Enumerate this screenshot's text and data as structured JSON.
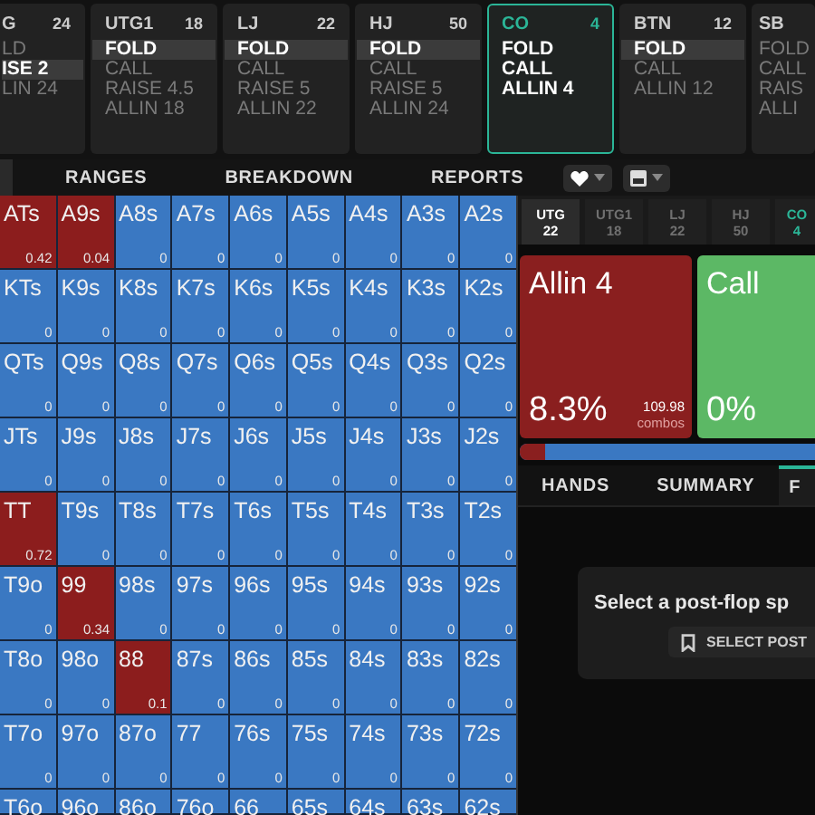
{
  "positions": [
    {
      "name": "G",
      "stack": "24",
      "active": false,
      "actions": [
        {
          "label": "LD",
          "selected": false
        },
        {
          "label": "ISE 2",
          "selected": true
        },
        {
          "label": "LIN 24",
          "selected": false
        }
      ]
    },
    {
      "name": "UTG1",
      "stack": "18",
      "active": false,
      "actions": [
        {
          "label": "FOLD",
          "selected": true
        },
        {
          "label": "CALL",
          "selected": false
        },
        {
          "label": "RAISE 4.5",
          "selected": false
        },
        {
          "label": "ALLIN 18",
          "selected": false
        }
      ]
    },
    {
      "name": "LJ",
      "stack": "22",
      "active": false,
      "actions": [
        {
          "label": "FOLD",
          "selected": true
        },
        {
          "label": "CALL",
          "selected": false
        },
        {
          "label": "RAISE 5",
          "selected": false
        },
        {
          "label": "ALLIN 22",
          "selected": false
        }
      ]
    },
    {
      "name": "HJ",
      "stack": "50",
      "active": false,
      "actions": [
        {
          "label": "FOLD",
          "selected": true
        },
        {
          "label": "CALL",
          "selected": false
        },
        {
          "label": "RAISE 5",
          "selected": false
        },
        {
          "label": "ALLIN 24",
          "selected": false
        }
      ]
    },
    {
      "name": "CO",
      "stack": "4",
      "active": true,
      "actions": [
        {
          "label": "FOLD",
          "selected": false
        },
        {
          "label": "CALL",
          "selected": false
        },
        {
          "label": "ALLIN 4",
          "selected": false
        }
      ]
    },
    {
      "name": "BTN",
      "stack": "12",
      "active": false,
      "actions": [
        {
          "label": "FOLD",
          "selected": true
        },
        {
          "label": "CALL",
          "selected": false
        },
        {
          "label": "ALLIN 12",
          "selected": false
        }
      ]
    },
    {
      "name": "SB",
      "active": false,
      "actions": [
        {
          "label": "FOLD",
          "selected": false
        },
        {
          "label": "CALL",
          "selected": false
        },
        {
          "label": "RAIS",
          "selected": false
        },
        {
          "label": "ALLI",
          "selected": false
        }
      ]
    }
  ],
  "tabs": [
    {
      "label": "RANGES"
    },
    {
      "label": "BREAKDOWN"
    },
    {
      "label": "REPORTS"
    }
  ],
  "grid": {
    "rows": [
      [
        {
          "hand": "ATs",
          "value": "0.42",
          "kind": "allin"
        },
        {
          "hand": "A9s",
          "value": "0.04",
          "kind": "allin"
        },
        {
          "hand": "A8s",
          "value": "0",
          "kind": "fold"
        },
        {
          "hand": "A7s",
          "value": "0",
          "kind": "fold"
        },
        {
          "hand": "A6s",
          "value": "0",
          "kind": "fold"
        },
        {
          "hand": "A5s",
          "value": "0",
          "kind": "fold"
        },
        {
          "hand": "A4s",
          "value": "0",
          "kind": "fold"
        },
        {
          "hand": "A3s",
          "value": "0",
          "kind": "fold"
        },
        {
          "hand": "A2s",
          "value": "0",
          "kind": "fold"
        }
      ],
      [
        {
          "hand": "KTs",
          "value": "0",
          "kind": "fold"
        },
        {
          "hand": "K9s",
          "value": "0",
          "kind": "fold"
        },
        {
          "hand": "K8s",
          "value": "0",
          "kind": "fold"
        },
        {
          "hand": "K7s",
          "value": "0",
          "kind": "fold"
        },
        {
          "hand": "K6s",
          "value": "0",
          "kind": "fold"
        },
        {
          "hand": "K5s",
          "value": "0",
          "kind": "fold"
        },
        {
          "hand": "K4s",
          "value": "0",
          "kind": "fold"
        },
        {
          "hand": "K3s",
          "value": "0",
          "kind": "fold"
        },
        {
          "hand": "K2s",
          "value": "0",
          "kind": "fold"
        }
      ],
      [
        {
          "hand": "QTs",
          "value": "0",
          "kind": "fold"
        },
        {
          "hand": "Q9s",
          "value": "0",
          "kind": "fold"
        },
        {
          "hand": "Q8s",
          "value": "0",
          "kind": "fold"
        },
        {
          "hand": "Q7s",
          "value": "0",
          "kind": "fold"
        },
        {
          "hand": "Q6s",
          "value": "0",
          "kind": "fold"
        },
        {
          "hand": "Q5s",
          "value": "0",
          "kind": "fold"
        },
        {
          "hand": "Q4s",
          "value": "0",
          "kind": "fold"
        },
        {
          "hand": "Q3s",
          "value": "0",
          "kind": "fold"
        },
        {
          "hand": "Q2s",
          "value": "0",
          "kind": "fold"
        }
      ],
      [
        {
          "hand": "JTs",
          "value": "0",
          "kind": "fold"
        },
        {
          "hand": "J9s",
          "value": "0",
          "kind": "fold"
        },
        {
          "hand": "J8s",
          "value": "0",
          "kind": "fold"
        },
        {
          "hand": "J7s",
          "value": "0",
          "kind": "fold"
        },
        {
          "hand": "J6s",
          "value": "0",
          "kind": "fold"
        },
        {
          "hand": "J5s",
          "value": "0",
          "kind": "fold"
        },
        {
          "hand": "J4s",
          "value": "0",
          "kind": "fold"
        },
        {
          "hand": "J3s",
          "value": "0",
          "kind": "fold"
        },
        {
          "hand": "J2s",
          "value": "0",
          "kind": "fold"
        }
      ],
      [
        {
          "hand": "TT",
          "value": "0.72",
          "kind": "allin"
        },
        {
          "hand": "T9s",
          "value": "0",
          "kind": "fold"
        },
        {
          "hand": "T8s",
          "value": "0",
          "kind": "fold"
        },
        {
          "hand": "T7s",
          "value": "0",
          "kind": "fold"
        },
        {
          "hand": "T6s",
          "value": "0",
          "kind": "fold"
        },
        {
          "hand": "T5s",
          "value": "0",
          "kind": "fold"
        },
        {
          "hand": "T4s",
          "value": "0",
          "kind": "fold"
        },
        {
          "hand": "T3s",
          "value": "0",
          "kind": "fold"
        },
        {
          "hand": "T2s",
          "value": "0",
          "kind": "fold"
        }
      ],
      [
        {
          "hand": "T9o",
          "value": "0",
          "kind": "fold"
        },
        {
          "hand": "99",
          "value": "0.34",
          "kind": "allin"
        },
        {
          "hand": "98s",
          "value": "0",
          "kind": "fold"
        },
        {
          "hand": "97s",
          "value": "0",
          "kind": "fold"
        },
        {
          "hand": "96s",
          "value": "0",
          "kind": "fold"
        },
        {
          "hand": "95s",
          "value": "0",
          "kind": "fold"
        },
        {
          "hand": "94s",
          "value": "0",
          "kind": "fold"
        },
        {
          "hand": "93s",
          "value": "0",
          "kind": "fold"
        },
        {
          "hand": "92s",
          "value": "0",
          "kind": "fold"
        }
      ],
      [
        {
          "hand": "T8o",
          "value": "0",
          "kind": "fold"
        },
        {
          "hand": "98o",
          "value": "0",
          "kind": "fold"
        },
        {
          "hand": "88",
          "value": "0.1",
          "kind": "allin"
        },
        {
          "hand": "87s",
          "value": "0",
          "kind": "fold"
        },
        {
          "hand": "86s",
          "value": "0",
          "kind": "fold"
        },
        {
          "hand": "85s",
          "value": "0",
          "kind": "fold"
        },
        {
          "hand": "84s",
          "value": "0",
          "kind": "fold"
        },
        {
          "hand": "83s",
          "value": "0",
          "kind": "fold"
        },
        {
          "hand": "82s",
          "value": "0",
          "kind": "fold"
        }
      ],
      [
        {
          "hand": "T7o",
          "value": "0",
          "kind": "fold"
        },
        {
          "hand": "97o",
          "value": "0",
          "kind": "fold"
        },
        {
          "hand": "87o",
          "value": "0",
          "kind": "fold"
        },
        {
          "hand": "77",
          "value": "0",
          "kind": "fold"
        },
        {
          "hand": "76s",
          "value": "0",
          "kind": "fold"
        },
        {
          "hand": "75s",
          "value": "0",
          "kind": "fold"
        },
        {
          "hand": "74s",
          "value": "0",
          "kind": "fold"
        },
        {
          "hand": "73s",
          "value": "0",
          "kind": "fold"
        },
        {
          "hand": "72s",
          "value": "0",
          "kind": "fold"
        }
      ],
      [
        {
          "hand": "T6o",
          "kind": "fold"
        },
        {
          "hand": "96o",
          "kind": "fold"
        },
        {
          "hand": "86o",
          "kind": "fold"
        },
        {
          "hand": "76o",
          "kind": "fold"
        },
        {
          "hand": "66",
          "kind": "fold"
        },
        {
          "hand": "65s",
          "kind": "fold"
        },
        {
          "hand": "64s",
          "kind": "fold"
        },
        {
          "hand": "63s",
          "kind": "fold"
        },
        {
          "hand": "62s",
          "kind": "fold"
        }
      ]
    ]
  },
  "side": {
    "positions": [
      {
        "name": "UTG",
        "stack": "22",
        "selected": true,
        "current": false
      },
      {
        "name": "UTG1",
        "stack": "18",
        "selected": false,
        "current": false
      },
      {
        "name": "LJ",
        "stack": "22",
        "selected": false,
        "current": false
      },
      {
        "name": "HJ",
        "stack": "50",
        "selected": false,
        "current": false
      },
      {
        "name": "CO",
        "stack": "4",
        "selected": false,
        "current": true
      }
    ],
    "actions": [
      {
        "kind": "allin",
        "label": "Allin 4",
        "percent": "8.3%",
        "combos": "109.98",
        "combos_label": "combos"
      },
      {
        "kind": "call",
        "label": "Call",
        "percent": "0%"
      }
    ],
    "range_bar": {
      "level": 0.083
    },
    "tabs": [
      {
        "label": "HANDS",
        "selected": false
      },
      {
        "label": "SUMMARY",
        "selected": false
      },
      {
        "label": "F",
        "selected": true
      }
    ],
    "prompt": {
      "text": "Select a post-flop sp",
      "button": "SELECT POST"
    }
  }
}
